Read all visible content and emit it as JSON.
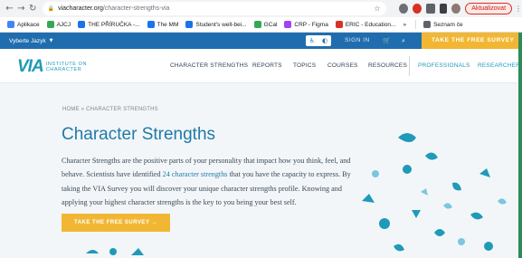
{
  "browser": {
    "url_host": "viacharacter.org",
    "url_path": "/character-strengths-via",
    "update_label": "Aktualizovat",
    "bookmarks": [
      {
        "label": "Aplikace",
        "color": "#4285f4"
      },
      {
        "label": "AJCJ",
        "color": "#34a853"
      },
      {
        "label": "THE PŘÍRUČKA -...",
        "color": "#1a73e8"
      },
      {
        "label": "The MM",
        "color": "#1a73e8"
      },
      {
        "label": "Student's well-bei...",
        "color": "#1a73e8"
      },
      {
        "label": "GCal",
        "color": "#34a853"
      },
      {
        "label": "CRP - Figma",
        "color": "#a142f4"
      },
      {
        "label": "ERIC - Education...",
        "color": "#d93025"
      }
    ],
    "bookmarks_overflow": "»",
    "reading_list_label": "Seznam če"
  },
  "site_bar": {
    "language_label": "Vyberte Jazyk",
    "sign_in_label": "SIGN IN",
    "cta_label": "TAKE THE FREE SURVEY",
    "colors": {
      "bar": "#1f6dae",
      "accent": "#f1b734"
    }
  },
  "nav": {
    "logo_mark": "VIA",
    "logo_line1": "INSTITUTE ON",
    "logo_line2": "CHARACTER",
    "links": [
      "CHARACTER STRENGTHS",
      "REPORTS",
      "TOPICS",
      "COURSES",
      "RESOURCES",
      "PROFESSIONALS",
      "RESEARCHERS"
    ]
  },
  "hero": {
    "breadcrumb": "HOME » CHARACTER STRENGTHS",
    "title": "Character Strengths",
    "intro_part1": "Character Strengths are the positive parts of your personality that impact how you think, feel, and behave. Scientists have identified ",
    "intro_link": "24 character strengths",
    "intro_part2": " that you have the capacity to express. By taking the VIA Survey you will discover your unique character strengths profile. Knowing and applying your highest character strengths is the key to you being your best self.",
    "cta_label": "TAKE THE FREE SURVEY  →"
  }
}
